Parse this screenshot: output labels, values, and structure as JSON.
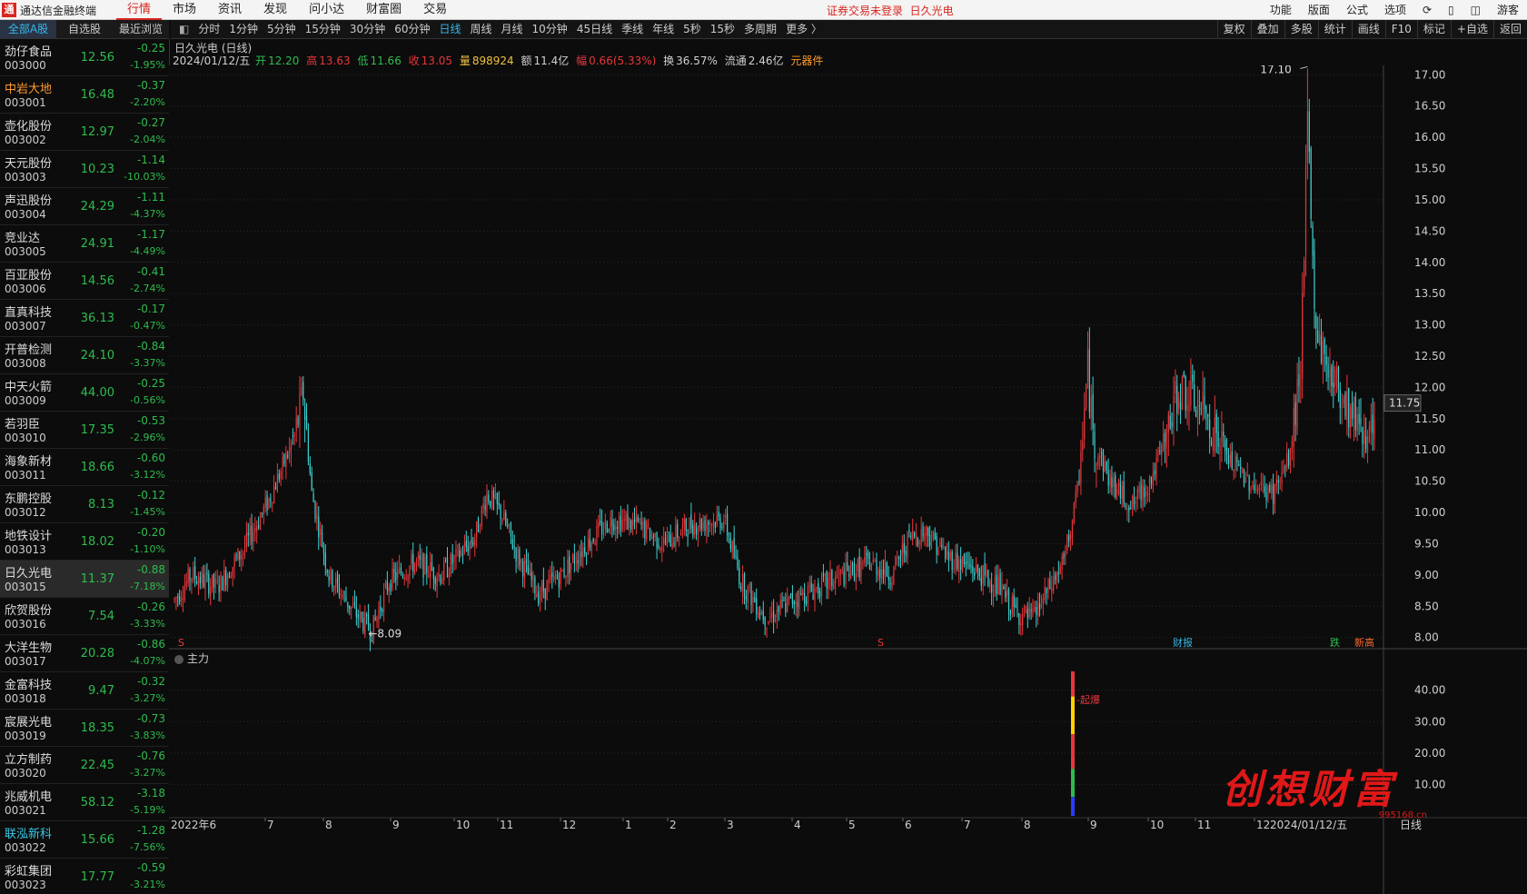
{
  "app": {
    "title": "通达信金融终端",
    "logo_text": "通",
    "menu": [
      "行情",
      "市场",
      "资讯",
      "发现",
      "问小达",
      "财富圈",
      "交易"
    ],
    "active_menu": "行情",
    "login_notice": "证券交易未登录",
    "current_stock_top": "日久光电",
    "right_menu": [
      "功能",
      "版面",
      "公式",
      "选项",
      "⟳",
      "▯",
      "◫",
      "游客"
    ]
  },
  "list_tabs": [
    "全部A股",
    "自选股",
    "最近浏览"
  ],
  "stocks": [
    {
      "name": "劲仔食品",
      "code": "003000",
      "price": "12.56",
      "change": "-0.25",
      "pct": "-1.95%"
    },
    {
      "name": "中岩大地",
      "code": "003001",
      "price": "16.48",
      "change": "-0.37",
      "pct": "-2.20%",
      "color": "orange"
    },
    {
      "name": "壶化股份",
      "code": "003002",
      "price": "12.97",
      "change": "-0.27",
      "pct": "-2.04%"
    },
    {
      "name": "天元股份",
      "code": "003003",
      "price": "10.23",
      "change": "-1.14",
      "pct": "-10.03%"
    },
    {
      "name": "声迅股份",
      "code": "003004",
      "price": "24.29",
      "change": "-1.11",
      "pct": "-4.37%"
    },
    {
      "name": "竞业达",
      "code": "003005",
      "price": "24.91",
      "change": "-1.17",
      "pct": "-4.49%"
    },
    {
      "name": "百亚股份",
      "code": "003006",
      "price": "14.56",
      "change": "-0.41",
      "pct": "-2.74%"
    },
    {
      "name": "直真科技",
      "code": "003007",
      "price": "36.13",
      "change": "-0.17",
      "pct": "-0.47%"
    },
    {
      "name": "开普检测",
      "code": "003008",
      "price": "24.10",
      "change": "-0.84",
      "pct": "-3.37%"
    },
    {
      "name": "中天火箭",
      "code": "003009",
      "price": "44.00",
      "change": "-0.25",
      "pct": "-0.56%"
    },
    {
      "name": "若羽臣",
      "code": "003010",
      "price": "17.35",
      "change": "-0.53",
      "pct": "-2.96%"
    },
    {
      "name": "海象新材",
      "code": "003011",
      "price": "18.66",
      "change": "-0.60",
      "pct": "-3.12%"
    },
    {
      "name": "东鹏控股",
      "code": "003012",
      "price": "8.13",
      "change": "-0.12",
      "pct": "-1.45%"
    },
    {
      "name": "地铁设计",
      "code": "003013",
      "price": "18.02",
      "change": "-0.20",
      "pct": "-1.10%"
    },
    {
      "name": "日久光电",
      "code": "003015",
      "price": "11.37",
      "change": "-0.88",
      "pct": "-7.18%",
      "selected": true
    },
    {
      "name": "欣贺股份",
      "code": "003016",
      "price": "7.54",
      "change": "-0.26",
      "pct": "-3.33%"
    },
    {
      "name": "大洋生物",
      "code": "003017",
      "price": "20.28",
      "change": "-0.86",
      "pct": "-4.07%"
    },
    {
      "name": "金富科技",
      "code": "003018",
      "price": "9.47",
      "change": "-0.32",
      "pct": "-3.27%"
    },
    {
      "name": "宸展光电",
      "code": "003019",
      "price": "18.35",
      "change": "-0.73",
      "pct": "-3.83%"
    },
    {
      "name": "立方制药",
      "code": "003020",
      "price": "22.45",
      "change": "-0.76",
      "pct": "-3.27%"
    },
    {
      "name": "兆威机电",
      "code": "003021",
      "price": "58.12",
      "change": "-3.18",
      "pct": "-5.19%"
    },
    {
      "name": "联泓新科",
      "code": "003022",
      "price": "15.66",
      "change": "-1.28",
      "pct": "-7.56%",
      "color": "cyan"
    },
    {
      "name": "彩虹集团",
      "code": "003023",
      "price": "17.77",
      "change": "-0.59",
      "pct": "-3.21%"
    }
  ],
  "periods": [
    "分时",
    "1分钟",
    "5分钟",
    "15分钟",
    "30分钟",
    "60分钟",
    "日线",
    "周线",
    "月线",
    "10分钟",
    "45日线",
    "季线",
    "年线",
    "5秒",
    "15秒",
    "多周期",
    "更多 〉"
  ],
  "active_period": "日线",
  "tools": [
    "复权",
    "叠加",
    "多股",
    "统计",
    "画线",
    "F10",
    "标记",
    "+自选",
    "返回"
  ],
  "chart_title": "日久光电 (日线)",
  "info": {
    "date": "2024/01/12/五",
    "open_label": "开",
    "open": "12.20",
    "high_label": "高",
    "high": "13.63",
    "low_label": "低",
    "low": "11.66",
    "close_label": "收",
    "close": "13.05",
    "vol_label": "量",
    "vol": "898924",
    "amt_label": "额",
    "amt": "11.4亿",
    "amp_label": "幅",
    "amp": "0.66(5.33%)",
    "turn_label": "换",
    "turn": "36.57%",
    "float_label": "流通",
    "float": "2.46亿",
    "sector": "元器件"
  },
  "sub_indicator": "主力",
  "sub_label": "起爆",
  "watermark": {
    "text": "创想财富",
    "url": "995168.cn"
  },
  "chart_data": {
    "type": "candlestick",
    "y_ticks": [
      "17.00",
      "16.50",
      "16.00",
      "15.50",
      "15.00",
      "14.50",
      "14.00",
      "13.50",
      "13.00",
      "12.50",
      "12.00",
      "11.50",
      "11.00",
      "10.50",
      "10.00",
      "9.50",
      "9.00",
      "8.50",
      "8.00"
    ],
    "ylim": [
      7.85,
      17.15
    ],
    "x_ticks": [
      "2022年6",
      "7",
      "8",
      "9",
      "10",
      "11",
      "12",
      "1",
      "2",
      "3",
      "4",
      "5",
      "6",
      "7",
      "8",
      "9",
      "10",
      "11",
      "12",
      "2024/01/12/五",
      "日线"
    ],
    "max_label": "17.10",
    "min_label": "8.09",
    "current_price": "11.75",
    "markers": [
      "S",
      "S",
      "财报",
      "跌",
      "新高"
    ],
    "sub_y_ticks": [
      "40.00",
      "30.00",
      "20.00",
      "10.00"
    ],
    "sub_ylim": [
      0,
      48
    ],
    "colors": {
      "up": "#e8363b",
      "down": "#3fd1d1",
      "grid": "#2a2a2a",
      "axis": "#cfcfcf"
    },
    "anchors": [
      [
        0,
        8.6
      ],
      [
        10,
        9.0
      ],
      [
        25,
        8.8
      ],
      [
        40,
        9.4
      ],
      [
        55,
        10.2
      ],
      [
        70,
        11.2
      ],
      [
        75,
        11.9
      ],
      [
        80,
        10.3
      ],
      [
        90,
        9.0
      ],
      [
        105,
        8.4
      ],
      [
        115,
        8.1
      ],
      [
        125,
        8.9
      ],
      [
        140,
        9.2
      ],
      [
        155,
        9.0
      ],
      [
        165,
        9.3
      ],
      [
        175,
        9.6
      ],
      [
        182,
        10.3
      ],
      [
        190,
        10.0
      ],
      [
        200,
        9.3
      ],
      [
        212,
        8.7
      ],
      [
        225,
        9.0
      ],
      [
        240,
        9.5
      ],
      [
        255,
        9.9
      ],
      [
        270,
        9.8
      ],
      [
        285,
        9.5
      ],
      [
        300,
        9.8
      ],
      [
        320,
        9.9
      ],
      [
        330,
        8.9
      ],
      [
        345,
        8.3
      ],
      [
        360,
        8.6
      ],
      [
        375,
        8.8
      ],
      [
        390,
        9.0
      ],
      [
        405,
        9.2
      ],
      [
        418,
        9.0
      ],
      [
        428,
        9.6
      ],
      [
        438,
        9.7
      ],
      [
        450,
        9.3
      ],
      [
        465,
        9.1
      ],
      [
        480,
        8.8
      ],
      [
        490,
        8.4
      ],
      [
        500,
        8.3
      ],
      [
        510,
        8.8
      ],
      [
        518,
        9.2
      ],
      [
        526,
        10.3
      ],
      [
        532,
        12.3
      ],
      [
        535,
        11.2
      ],
      [
        545,
        10.5
      ],
      [
        558,
        10.1
      ],
      [
        570,
        10.6
      ],
      [
        578,
        11.2
      ],
      [
        585,
        12.0
      ],
      [
        600,
        11.6
      ],
      [
        615,
        10.8
      ],
      [
        630,
        10.4
      ],
      [
        640,
        10.3
      ],
      [
        650,
        10.9
      ],
      [
        656,
        12.4
      ],
      [
        660,
        16.2
      ],
      [
        664,
        13.2
      ],
      [
        670,
        12.4
      ],
      [
        678,
        12.0
      ],
      [
        685,
        11.6
      ],
      [
        690,
        11.5
      ],
      [
        695,
        11.2
      ]
    ]
  }
}
